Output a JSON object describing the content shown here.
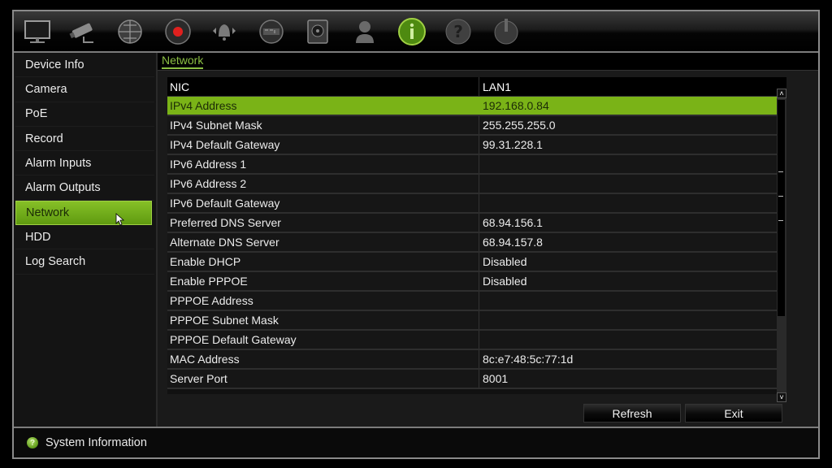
{
  "toolbar": {
    "icons": [
      {
        "name": "display-icon",
        "label": "Display"
      },
      {
        "name": "camera-icon",
        "label": "Camera"
      },
      {
        "name": "network-globe-icon",
        "label": "Network"
      },
      {
        "name": "record-icon",
        "label": "Record"
      },
      {
        "name": "alarm-icon",
        "label": "Alarm"
      },
      {
        "name": "device-icon",
        "label": "Device"
      },
      {
        "name": "hdd-icon",
        "label": "HDD"
      },
      {
        "name": "user-icon",
        "label": "User"
      },
      {
        "name": "info-icon",
        "label": "System Information",
        "active": true
      },
      {
        "name": "help-icon",
        "label": "Help"
      },
      {
        "name": "power-icon",
        "label": "Shutdown"
      }
    ],
    "accent_color": "#7ab317",
    "record_color": "#e0201e"
  },
  "sidebar": {
    "items": [
      {
        "label": "Device Info"
      },
      {
        "label": "Camera"
      },
      {
        "label": "PoE"
      },
      {
        "label": "Record"
      },
      {
        "label": "Alarm Inputs"
      },
      {
        "label": "Alarm Outputs"
      },
      {
        "label": "Network",
        "active": true
      },
      {
        "label": "HDD"
      },
      {
        "label": "Log Search"
      }
    ]
  },
  "content": {
    "section_tab": "Network",
    "table": {
      "header": [
        "NIC",
        "LAN1"
      ],
      "rows": [
        {
          "name": "IPv4 Address",
          "value": "192.168.0.84",
          "selected": true
        },
        {
          "name": "IPv4 Subnet Mask",
          "value": "255.255.255.0"
        },
        {
          "name": "IPv4 Default Gateway",
          "value": "99.31.228.1"
        },
        {
          "name": "IPv6 Address 1",
          "value": ""
        },
        {
          "name": "IPv6 Address 2",
          "value": ""
        },
        {
          "name": "IPv6 Default Gateway",
          "value": ""
        },
        {
          "name": "Preferred DNS Server",
          "value": "68.94.156.1"
        },
        {
          "name": "Alternate DNS Server",
          "value": "68.94.157.8"
        },
        {
          "name": "Enable DHCP",
          "value": "Disabled"
        },
        {
          "name": "Enable PPPOE",
          "value": "Disabled"
        },
        {
          "name": "PPPOE Address",
          "value": ""
        },
        {
          "name": "PPPOE Subnet Mask",
          "value": ""
        },
        {
          "name": "PPPOE Default Gateway",
          "value": ""
        },
        {
          "name": "MAC Address",
          "value": "8c:e7:48:5c:77:1d"
        },
        {
          "name": "Server Port",
          "value": "8001"
        }
      ]
    },
    "scroll": {
      "up": "˄",
      "down": "˅"
    },
    "buttons": {
      "refresh": "Refresh",
      "exit": "Exit"
    }
  },
  "status": {
    "icon": "?",
    "text": "System Information"
  }
}
